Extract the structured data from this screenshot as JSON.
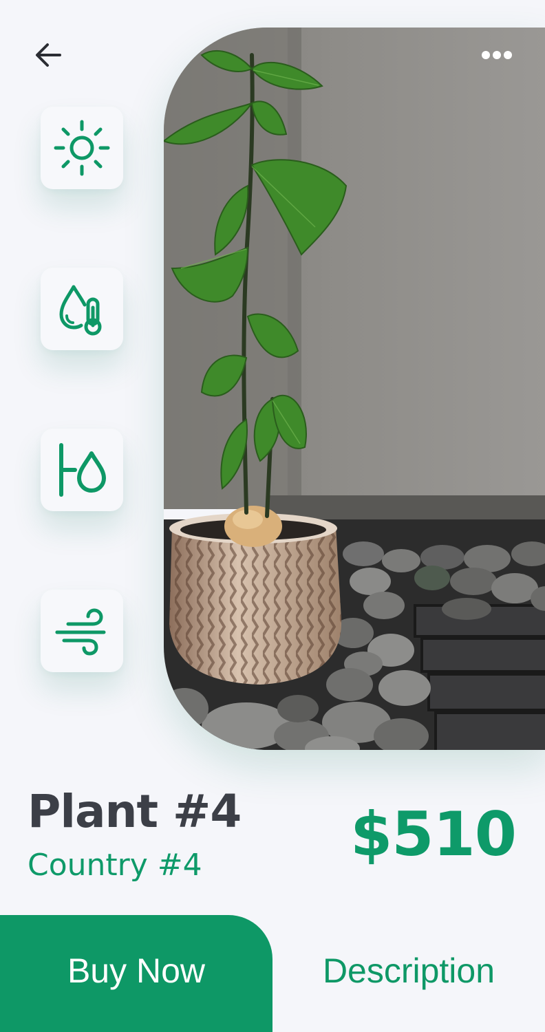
{
  "navigation": {
    "back_icon": "arrow-left-icon",
    "more_icon": "more-horizontal-icon"
  },
  "conditions": [
    {
      "icon": "sun-icon"
    },
    {
      "icon": "humidity-temperature-icon"
    },
    {
      "icon": "water-level-icon"
    },
    {
      "icon": "wind-icon"
    }
  ],
  "product": {
    "name": "Plant #4",
    "country": "Country #4",
    "price": "$510"
  },
  "actions": {
    "buy_label": "Buy Now",
    "description_label": "Description"
  },
  "colors": {
    "accent": "#0e9866",
    "title": "#3c3f47",
    "background": "#f5f6fa"
  }
}
